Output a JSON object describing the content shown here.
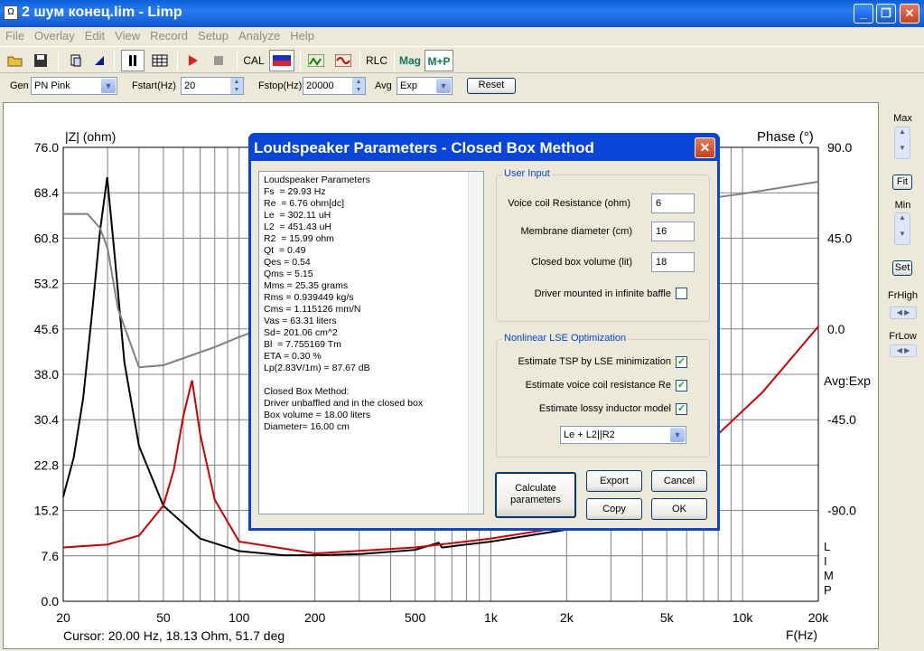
{
  "window": {
    "title": "2 шум конец.lim - Limp",
    "icon": "app-icon"
  },
  "menu": [
    "File",
    "Overlay",
    "Edit",
    "View",
    "Record",
    "Setup",
    "Analyze",
    "Help"
  ],
  "toolbar": {
    "cal": "CAL",
    "rlc": "RLC",
    "mag": "Mag",
    "mp": "M+P"
  },
  "gen": {
    "label": "Gen",
    "value": "PN Pink",
    "fstart_label": "Fstart(Hz)",
    "fstart": "20",
    "fstop_label": "Fstop(Hz)",
    "fstop": "20000",
    "avg_label": "Avg",
    "avg": "Exp",
    "reset": "Reset"
  },
  "chart_data": {
    "type": "line",
    "ylabel": "|Z| (ohm)",
    "y2label": "Phase (°)",
    "xlabel": "F(Hz)",
    "ylim": [
      0,
      76
    ],
    "y2lim": [
      -135,
      90
    ],
    "xlim": [
      20,
      20000
    ],
    "xscale": "log",
    "yticks": [
      "76.0",
      "68.4",
      "60.8",
      "53.2",
      "45.6",
      "38.0",
      "30.4",
      "22.8",
      "15.2",
      "7.6",
      "0.0"
    ],
    "y2ticks": [
      "90.0",
      "45.0",
      "0.0",
      "-45.0",
      "-90.0"
    ],
    "xticks": [
      "20",
      "50",
      "100",
      "200",
      "500",
      "1k",
      "2k",
      "5k",
      "10k",
      "20k"
    ],
    "annotations": [
      "Avg:Exp",
      "L",
      "I",
      "M",
      "P"
    ],
    "series": [
      {
        "color": "#000000",
        "x": [
          20,
          22,
          24,
          26,
          28,
          29.9,
          32,
          35,
          40,
          50,
          70,
          100,
          150,
          200,
          300,
          500,
          620,
          640,
          700,
          1000,
          2000
        ],
        "y": [
          17.5,
          24,
          34,
          48,
          62,
          71,
          58,
          40,
          26,
          16,
          10.5,
          8.4,
          7.7,
          7.7,
          7.9,
          8.6,
          9.8,
          9.0,
          9.2,
          10,
          12
        ]
      },
      {
        "color": "#cc0000",
        "x": [
          20,
          30,
          40,
          50,
          55,
          60,
          65,
          70,
          80,
          100,
          200,
          500,
          1000,
          2000,
          5000,
          8000,
          12000,
          20000
        ],
        "y": [
          9,
          9.5,
          11,
          16,
          22,
          31,
          37,
          28,
          17,
          10,
          8,
          9,
          10.5,
          12.5,
          20,
          28,
          35,
          46
        ]
      },
      {
        "color": "#808080",
        "x": [
          20,
          25,
          28,
          30,
          33,
          40,
          50,
          80,
          100,
          150,
          200,
          300,
          500,
          1000,
          2000,
          5000,
          10000,
          20000
        ],
        "y2": [
          57,
          57,
          50,
          40,
          10,
          -19,
          -18,
          -9,
          -4,
          4,
          10,
          17,
          26,
          40,
          52,
          62,
          67,
          73
        ]
      }
    ]
  },
  "cursor": "Cursor: 20.00 Hz, 18.13 Ohm, 51.7 deg",
  "right": {
    "max": "Max",
    "fit": "Fit",
    "min": "Min",
    "set": "Set",
    "frhigh": "FrHigh",
    "frlow": "FrLow"
  },
  "dialog": {
    "title": "Loudspeaker Parameters - Closed Box Method",
    "results": "Loudspeaker Parameters\nFs  = 29.93 Hz\nRe  = 6.76 ohm[dc]\nLe  = 302.11 uH\nL2  = 451.43 uH\nR2  = 15.99 ohm\nQt  = 0.49\nQes = 0.54\nQms = 5.15\nMms = 25.35 grams\nRms = 0.939449 kg/s\nCms = 1.115126 mm/N\nVas = 63.31 liters\nSd= 201.06 cm^2\nBl  = 7.755169 Tm\nETA = 0.30 %\nLp(2.83V/1m) = 87.67 dB\n\nClosed Box Method:\nDriver unbaffled and in the closed box\nBox volume = 18.00 liters\nDiameter= 16.00 cm",
    "user_input": "User Input",
    "vc_label": "Voice coil Resistance (ohm)",
    "vc_value": "6",
    "md_label": "Membrane diameter (cm)",
    "md_value": "16",
    "bv_label": "Closed box volume (lit)",
    "bv_value": "18",
    "baffle_label": "Driver mounted in infinite baffle",
    "nl_group": "Nonlinear LSE Optimization",
    "opt1": "Estimate TSP by LSE minimization",
    "opt2": "Estimate voice coil resistance Re",
    "opt3": "Estimate lossy inductor model",
    "model": "Le + L2||R2",
    "calc": "Calculate parameters",
    "export": "Export",
    "cancel": "Cancel",
    "copy": "Copy",
    "ok": "OK"
  }
}
